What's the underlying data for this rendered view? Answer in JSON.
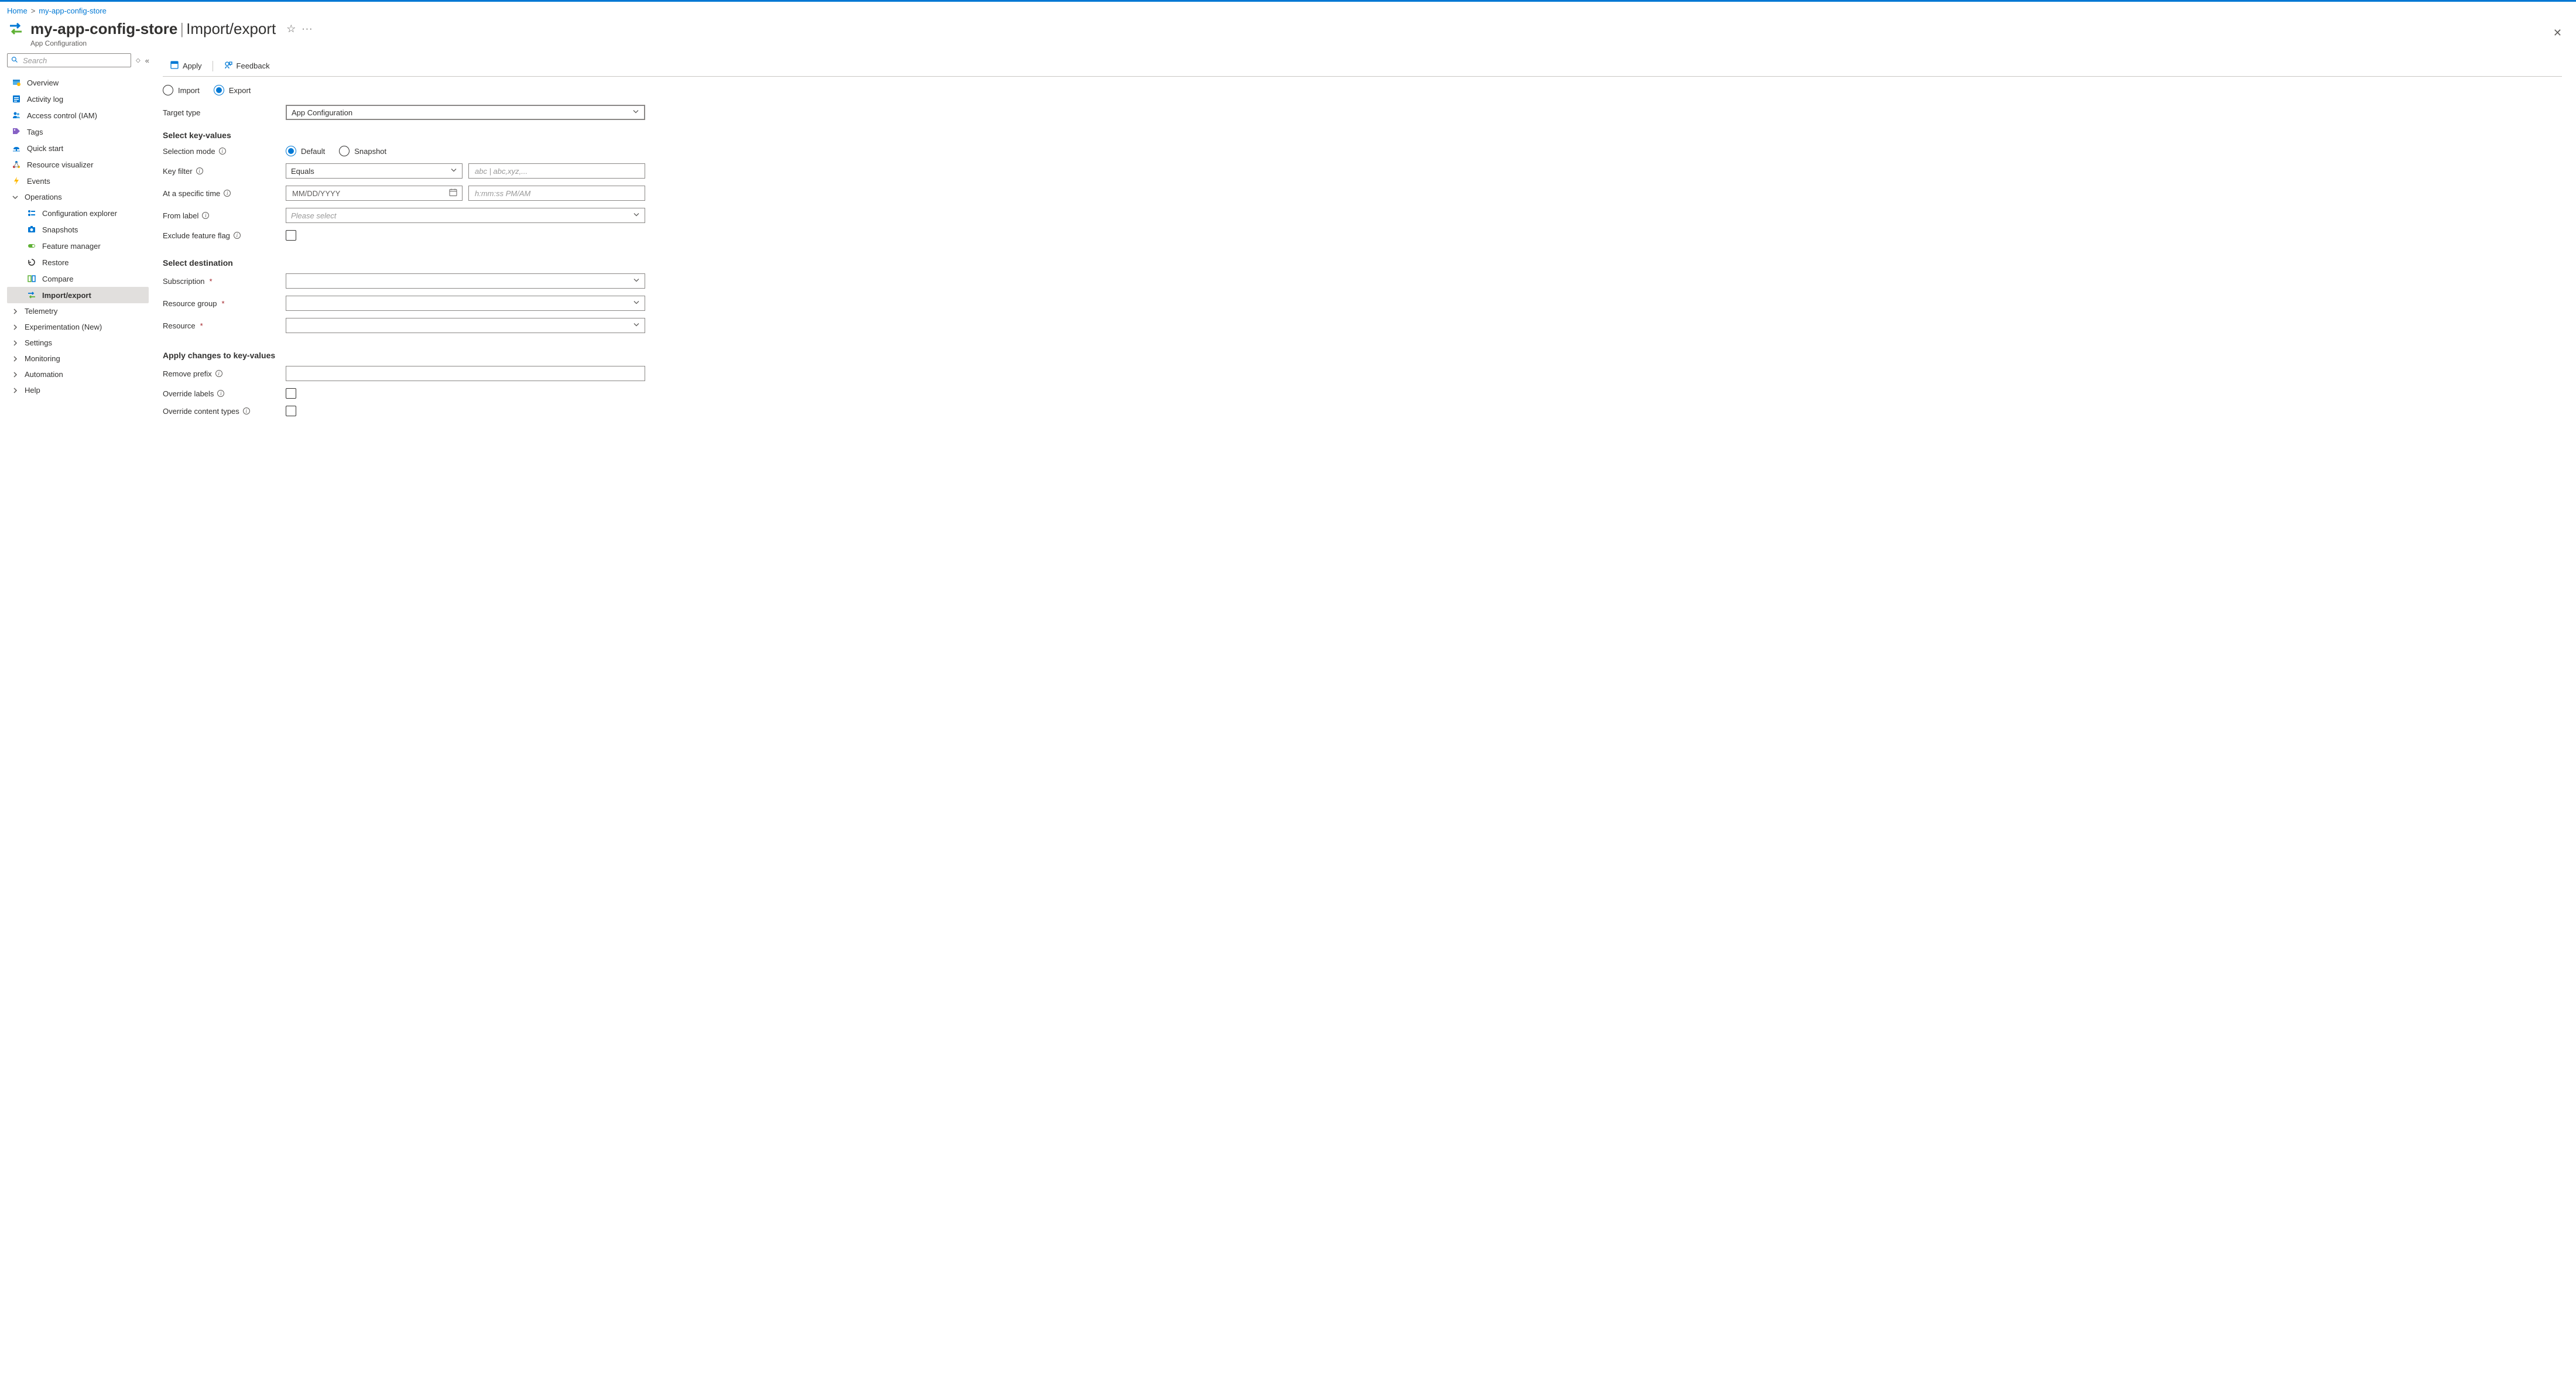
{
  "breadcrumb": {
    "home": "Home",
    "resource": "my-app-config-store"
  },
  "header": {
    "resource_name": "my-app-config-store",
    "section": "Import/export",
    "subtitle": "App Configuration"
  },
  "sidebar": {
    "search_placeholder": "Search",
    "items": {
      "overview": "Overview",
      "activity_log": "Activity log",
      "access_control": "Access control (IAM)",
      "tags": "Tags",
      "quick_start": "Quick start",
      "resource_visualizer": "Resource visualizer",
      "events": "Events"
    },
    "operations": {
      "label": "Operations",
      "configuration_explorer": "Configuration explorer",
      "snapshots": "Snapshots",
      "feature_manager": "Feature manager",
      "restore": "Restore",
      "compare": "Compare",
      "import_export": "Import/export"
    },
    "groups": {
      "telemetry": "Telemetry",
      "experimentation": "Experimentation (New)",
      "settings": "Settings",
      "monitoring": "Monitoring",
      "automation": "Automation",
      "help": "Help"
    }
  },
  "toolbar": {
    "apply": "Apply",
    "feedback": "Feedback"
  },
  "mode": {
    "import": "Import",
    "export": "Export"
  },
  "form": {
    "target_type_label": "Target type",
    "target_type_value": "App Configuration",
    "select_key_values": "Select key-values",
    "selection_mode_label": "Selection mode",
    "selection_mode_default": "Default",
    "selection_mode_snapshot": "Snapshot",
    "key_filter_label": "Key filter",
    "key_filter_op": "Equals",
    "key_filter_placeholder": "abc | abc,xyz,...",
    "specific_time_label": "At a specific time",
    "date_placeholder": "MM/DD/YYYY",
    "time_placeholder": "h:mm:ss PM/AM",
    "from_label_label": "From label",
    "from_label_placeholder": "Please select",
    "exclude_feature_flag_label": "Exclude feature flag",
    "select_destination": "Select destination",
    "subscription_label": "Subscription",
    "resource_group_label": "Resource group",
    "resource_label": "Resource",
    "apply_changes": "Apply changes to key-values",
    "remove_prefix_label": "Remove prefix",
    "override_labels_label": "Override labels",
    "override_content_types_label": "Override content types"
  }
}
